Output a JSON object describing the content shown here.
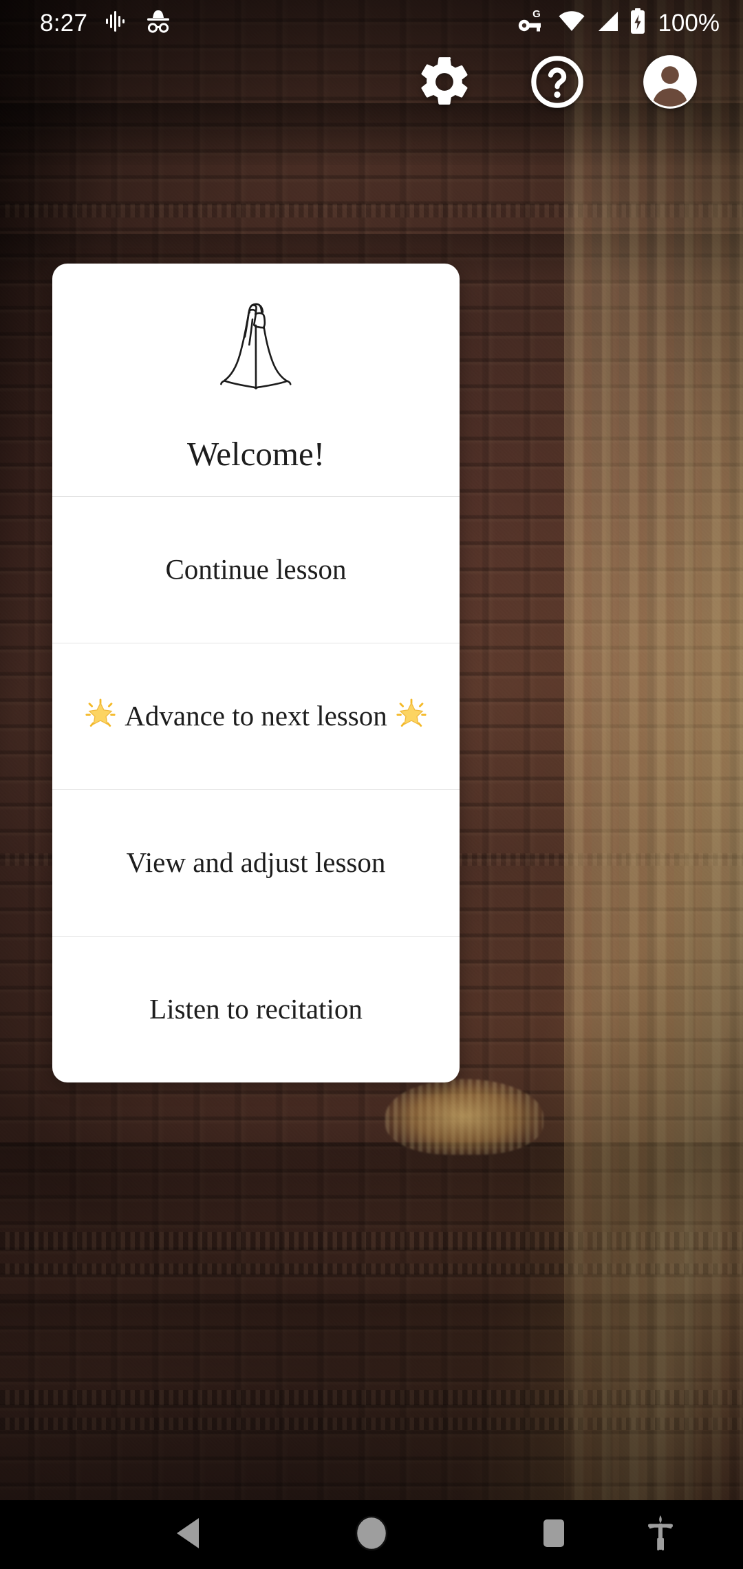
{
  "status_bar": {
    "clock": "8:27",
    "battery_percent": "100%",
    "icons": [
      "sound-waveform-icon",
      "incognito-icon",
      "vpn-key-g-icon",
      "wifi-icon",
      "cellular-signal-icon",
      "battery-charging-icon"
    ]
  },
  "app_bar": {
    "settings_label": "Settings",
    "help_label": "Help",
    "account_label": "Account",
    "icons": [
      "gear-icon",
      "help-circle-icon",
      "account-circle-icon"
    ]
  },
  "dialog": {
    "icon": "namaste-praying-hands-icon",
    "title": "Welcome!",
    "items": [
      {
        "label": "Continue lesson",
        "star": false
      },
      {
        "label": "Advance to next lesson",
        "star": true
      },
      {
        "label": "View and adjust lesson",
        "star": false
      },
      {
        "label": "Listen to recitation",
        "star": false
      }
    ]
  },
  "nav_bar": {
    "back_label": "Back",
    "home_label": "Home",
    "recents_label": "Recent apps",
    "accessibility_label": "Accessibility",
    "icons": [
      "back-triangle-icon",
      "home-circle-icon",
      "recents-square-icon",
      "accessibility-icon"
    ]
  },
  "colors": {
    "card_background": "#ffffff",
    "text_primary": "#1d1d1d",
    "divider": "#e4e4e4",
    "status_icons": "#ffffff",
    "nav_icons": "#9e9e9e",
    "nav_background": "#000000",
    "star_yellow": "#fcd462",
    "background_stone": "#5a382c",
    "background_sunlit": "#f3ca7e"
  }
}
